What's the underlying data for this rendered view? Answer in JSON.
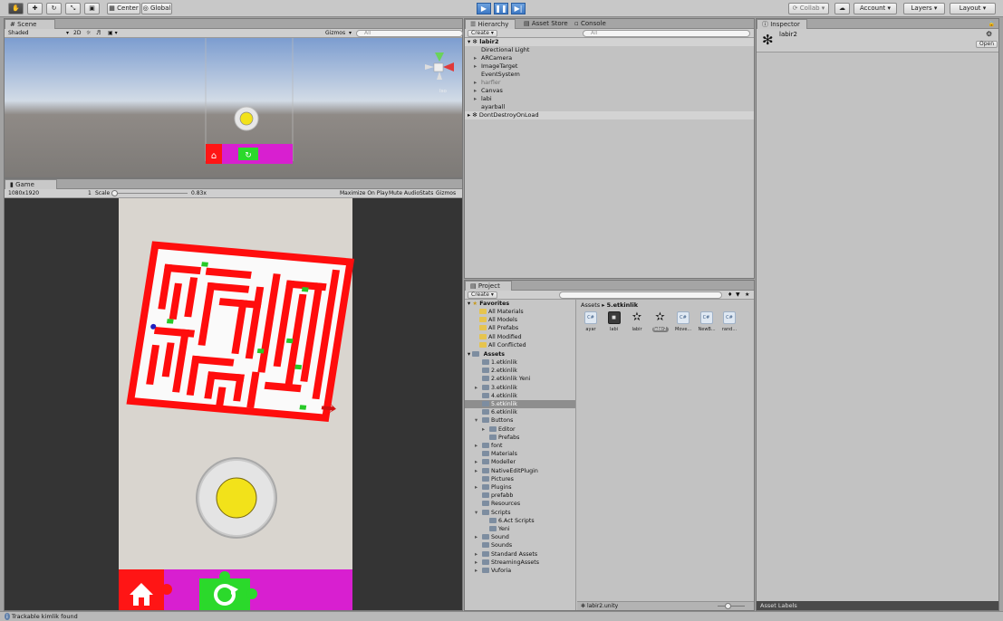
{
  "toolbar": {
    "pivot_label": "Center",
    "space_label": "Global",
    "collab_label": "Collab",
    "account_label": "Account",
    "layers_label": "Layers",
    "layout_label": "Layout"
  },
  "scene": {
    "tab": "Scene",
    "shading": "Shaded",
    "mode_2d": "2D",
    "gizmos": "Gizmos",
    "search_placeholder": "All",
    "persp_label": "Iso"
  },
  "game": {
    "tab": "Game",
    "resolution": "1080x1920",
    "scale_label": "Scale",
    "scale_value": "0.83x",
    "maximize_on_play": "Maximize On Play",
    "mute_audio": "Mute Audio",
    "stats": "Stats",
    "gizmos": "Gizmos",
    "slider_level": 0.0
  },
  "hierarchy": {
    "tabs": [
      "Hierarchy",
      "Asset Store",
      "Console"
    ],
    "create_label": "Create",
    "search_placeholder": "All",
    "scene_name": "labir2",
    "items": [
      {
        "label": "Directional Light",
        "arrow": false
      },
      {
        "label": "ARCamera",
        "arrow": true
      },
      {
        "label": "ImageTarget",
        "arrow": true
      },
      {
        "label": "EventSystem",
        "arrow": false
      },
      {
        "label": "harfler",
        "arrow": true,
        "dim": true
      },
      {
        "label": "Canvas",
        "arrow": true
      },
      {
        "label": "labi",
        "arrow": true
      },
      {
        "label": "ayarball",
        "arrow": false
      }
    ],
    "dont_destroy": "DontDestroyOnLoad"
  },
  "project": {
    "tab": "Project",
    "create_label": "Create",
    "breadcrumb_root": "Assets",
    "breadcrumb_sep": "▸",
    "breadcrumb_current": "5.etkinlik",
    "favorites_label": "Favorites",
    "favorites": [
      "All Materials",
      "All Models",
      "All Prefabs",
      "All Modified",
      "All Conflicted"
    ],
    "assets_label": "Assets",
    "folders": [
      {
        "label": "1.etkinlik",
        "indent": 1,
        "arrow": false
      },
      {
        "label": "2.etkinlik",
        "indent": 1,
        "arrow": false
      },
      {
        "label": "2.etkinlik Yeni",
        "indent": 1,
        "arrow": false
      },
      {
        "label": "3.etkinlik",
        "indent": 1,
        "arrow": true
      },
      {
        "label": "4.etkinlik",
        "indent": 1,
        "arrow": false
      },
      {
        "label": "5.etkinlik",
        "indent": 1,
        "arrow": false,
        "selected": true
      },
      {
        "label": "6.etkinlik",
        "indent": 1,
        "arrow": false
      },
      {
        "label": "Buttons",
        "indent": 1,
        "arrow": true,
        "open": true
      },
      {
        "label": "Editor",
        "indent": 2,
        "arrow": true
      },
      {
        "label": "Prefabs",
        "indent": 2,
        "arrow": false
      },
      {
        "label": "font",
        "indent": 1,
        "arrow": true
      },
      {
        "label": "Materials",
        "indent": 1,
        "arrow": false
      },
      {
        "label": "Modeller",
        "indent": 1,
        "arrow": true
      },
      {
        "label": "NativeEditPlugin",
        "indent": 1,
        "arrow": true
      },
      {
        "label": "Pictures",
        "indent": 1,
        "arrow": false
      },
      {
        "label": "Plugins",
        "indent": 1,
        "arrow": true
      },
      {
        "label": "prefabb",
        "indent": 1,
        "arrow": false
      },
      {
        "label": "Resources",
        "indent": 1,
        "arrow": false
      },
      {
        "label": "Scripts",
        "indent": 1,
        "arrow": true,
        "open": true
      },
      {
        "label": "6.Act Scripts",
        "indent": 2,
        "arrow": false
      },
      {
        "label": "Yeni",
        "indent": 2,
        "arrow": false
      },
      {
        "label": "Sound",
        "indent": 1,
        "arrow": true
      },
      {
        "label": "Sounds",
        "indent": 1,
        "arrow": false
      },
      {
        "label": "Standard Assets",
        "indent": 1,
        "arrow": true
      },
      {
        "label": "StreamingAssets",
        "indent": 1,
        "arrow": true
      },
      {
        "label": "Vuforia",
        "indent": 1,
        "arrow": true
      }
    ],
    "assets": [
      {
        "name": "ayar",
        "kind": "script"
      },
      {
        "name": "labi",
        "kind": "prefab"
      },
      {
        "name": "labir",
        "kind": "scene"
      },
      {
        "name": "labir2",
        "kind": "scene",
        "selected": true
      },
      {
        "name": "Move...",
        "kind": "script"
      },
      {
        "name": "NewB...",
        "kind": "script"
      },
      {
        "name": "rand...",
        "kind": "script"
      }
    ],
    "footer_file": "labir2.unity"
  },
  "inspector": {
    "tab": "Inspector",
    "object_name": "labir2",
    "open_label": "Open",
    "asset_labels": "Asset Labels"
  },
  "status": {
    "message": "Trackable kimlik found"
  },
  "colors": {
    "maze_red": "#ff0d0d",
    "pad_magenta": "#d81fd0",
    "ball_yellow": "#f2e21a",
    "play_blue": "#3d78c4"
  }
}
